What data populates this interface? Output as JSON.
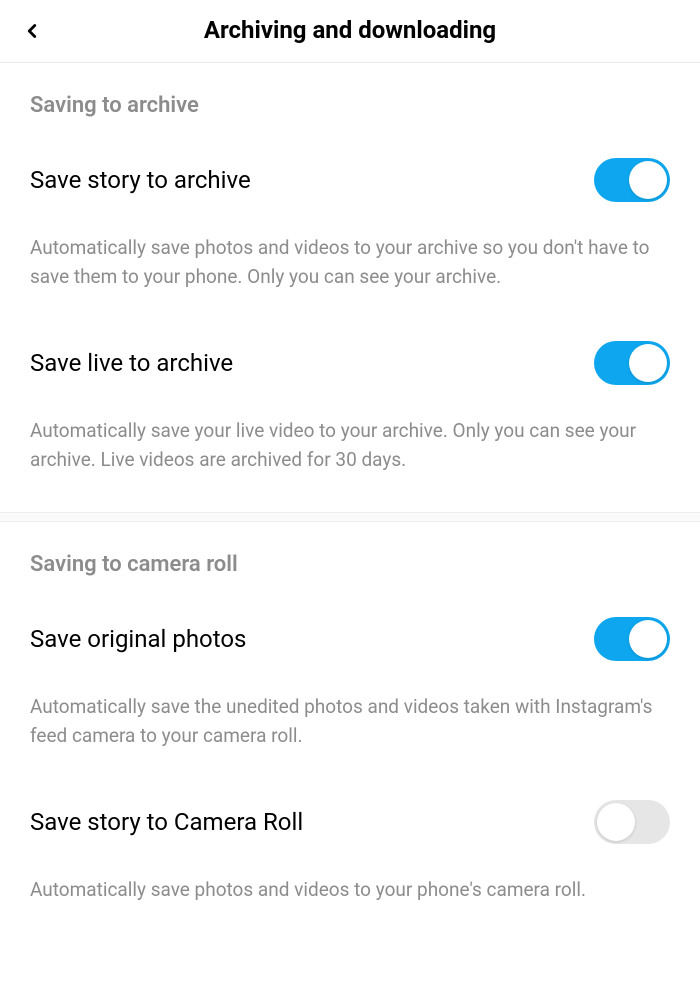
{
  "header": {
    "title": "Archiving and downloading"
  },
  "sections": {
    "archive": {
      "title": "Saving to archive",
      "items": [
        {
          "label": "Save story to archive",
          "description": "Automatically save photos and videos to your archive so you don't have to save them to your phone. Only you can see your archive.",
          "enabled": true
        },
        {
          "label": "Save live to archive",
          "description": "Automatically save your live video to your archive. Only you can see your archive. Live videos are archived for 30 days.",
          "enabled": true
        }
      ]
    },
    "cameraRoll": {
      "title": "Saving to camera roll",
      "items": [
        {
          "label": "Save original photos",
          "description": "Automatically save the unedited photos and videos taken with Instagram's feed camera to your camera roll.",
          "enabled": true
        },
        {
          "label": "Save story to Camera Roll",
          "description": "Automatically save photos and videos to your phone's camera roll.",
          "enabled": false
        }
      ]
    }
  }
}
